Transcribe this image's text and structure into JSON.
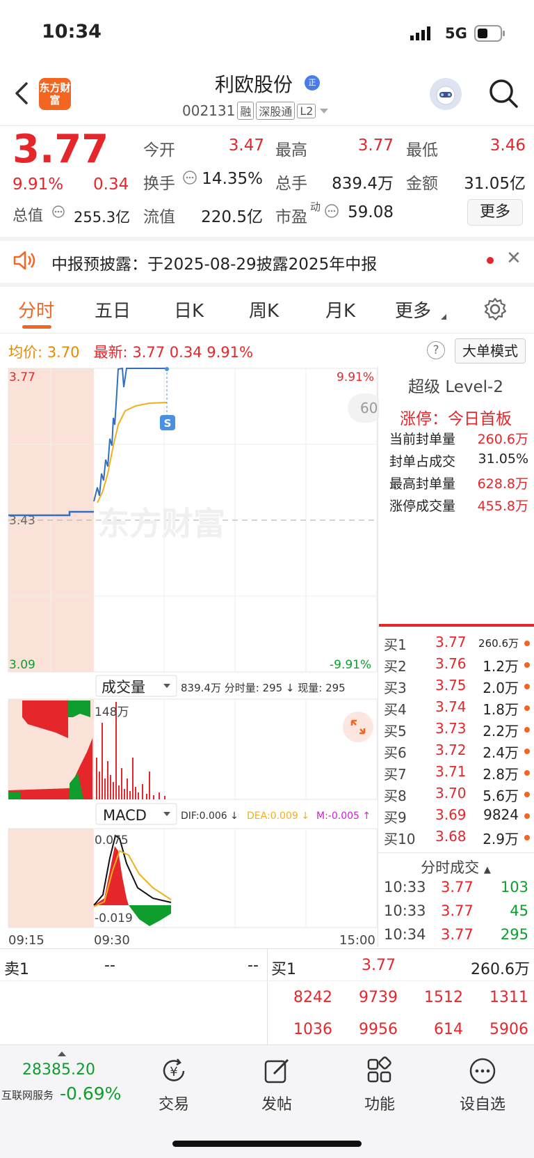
{
  "status": {
    "time": "10:34",
    "network": "5G"
  },
  "header": {
    "logo_text": "东方财富",
    "stock_name": "利欧股份",
    "name_tag": "正",
    "code": "002131",
    "tags": [
      "融",
      "深股通",
      "L2"
    ]
  },
  "quote": {
    "price": "3.77",
    "change_pct": "9.91%",
    "change": "0.34",
    "total_value_label": "总值",
    "total_value": "255.3亿",
    "fields": [
      {
        "label": "今开",
        "value": "3.47"
      },
      {
        "label": "最高",
        "value": "3.77"
      },
      {
        "label": "最低",
        "value": "3.46"
      },
      {
        "label": "换手",
        "value": "14.35%"
      },
      {
        "label": "总手",
        "value": "839.4万"
      },
      {
        "label": "金额",
        "value": "31.05亿"
      },
      {
        "label": "流值",
        "value": "220.5亿"
      },
      {
        "label": "市盈",
        "sup": "动",
        "value": "59.08"
      }
    ],
    "more_label": "更多"
  },
  "notice": {
    "text": "中报预披露：于2025-08-29披露2025年中报"
  },
  "tabs": [
    "分时",
    "五日",
    "日K",
    "周K",
    "月K",
    "更多"
  ],
  "info": {
    "avg_label": "均价:",
    "avg": "3.70",
    "latest_label": "最新:",
    "latest": "3.77",
    "latest_chg": "0.34",
    "latest_pct": "9.91%",
    "big_order_mode": "大单模式"
  },
  "chart": {
    "price_high": "3.77",
    "pct_high": "9.91%",
    "price_mid": "3.43",
    "price_low": "3.09",
    "pct_low": "-9.91%",
    "watermark": "东方财富",
    "s_marker": "S",
    "overlay_text": "60",
    "volume_label": "成交量",
    "volume_stats": "839.4万 分时量: 295 ↓ 现量: 295",
    "volume_peak": "148万",
    "macd_label": "MACD",
    "macd_dif": "DIF:0.006 ↓",
    "macd_dea": "DEA:0.009 ↓",
    "macd_m": "M:-0.005 ↑",
    "macd_top": "0.075",
    "macd_bottom": "-0.019",
    "time_start": "09:15",
    "time_open": "09:30",
    "time_end": "15:00",
    "colors": {
      "up": "#e5262b",
      "down": "#0f9d2e",
      "price_line": "#2f6fc4",
      "avg_line": "#f0b020",
      "auction_bg": "#fbe2d8"
    }
  },
  "level2": {
    "title": "超级 Level-2",
    "limit_status": "涨停：今日首板",
    "stats": [
      {
        "label": "当前封单量",
        "value": "260.6万"
      },
      {
        "label": "封单占成交",
        "value": "31.05%"
      },
      {
        "label": "最高封单量",
        "value": "628.8万"
      },
      {
        "label": "涨停成交量",
        "value": "455.8万"
      }
    ],
    "bids": [
      {
        "label": "买1",
        "price": "3.77",
        "vol": "260.6万"
      },
      {
        "label": "买2",
        "price": "3.76",
        "vol": "1.2万"
      },
      {
        "label": "买3",
        "price": "3.75",
        "vol": "2.0万"
      },
      {
        "label": "买4",
        "price": "3.74",
        "vol": "1.8万"
      },
      {
        "label": "买5",
        "price": "3.73",
        "vol": "2.2万"
      },
      {
        "label": "买6",
        "price": "3.72",
        "vol": "2.4万"
      },
      {
        "label": "买7",
        "price": "3.71",
        "vol": "2.8万"
      },
      {
        "label": "买8",
        "price": "3.70",
        "vol": "5.6万"
      },
      {
        "label": "买9",
        "price": "3.69",
        "vol": "9824"
      },
      {
        "label": "买10",
        "price": "3.68",
        "vol": "2.9万"
      }
    ],
    "ticks_title": "分时成交",
    "ticks": [
      {
        "time": "10:33",
        "price": "3.77",
        "vol": "103",
        "color": "#0f9d2e"
      },
      {
        "time": "10:33",
        "price": "3.77",
        "vol": "45",
        "color": "#0f9d2e"
      },
      {
        "time": "10:34",
        "price": "3.77",
        "vol": "295",
        "color": "#0f9d2e"
      }
    ]
  },
  "book": {
    "sell_label": "卖1",
    "sell_price": "--",
    "sell_vol": "--",
    "buy_label": "买1",
    "buy_price": "3.77",
    "buy_vol": "260.6万",
    "queue_row1": [
      "8242",
      "9739",
      "1512",
      "1311"
    ],
    "queue_row2": [
      "1036",
      "9956",
      "614",
      "5906"
    ]
  },
  "nav": {
    "index_value": "28385.20",
    "index_name": "互联网服务",
    "index_change": "-0.69%",
    "items": [
      {
        "label": "交易",
        "icon": "yen-exchange-icon"
      },
      {
        "label": "发帖",
        "icon": "edit-icon"
      },
      {
        "label": "功能",
        "icon": "grid-icon"
      },
      {
        "label": "设自选",
        "icon": "more-dots-icon"
      }
    ]
  }
}
